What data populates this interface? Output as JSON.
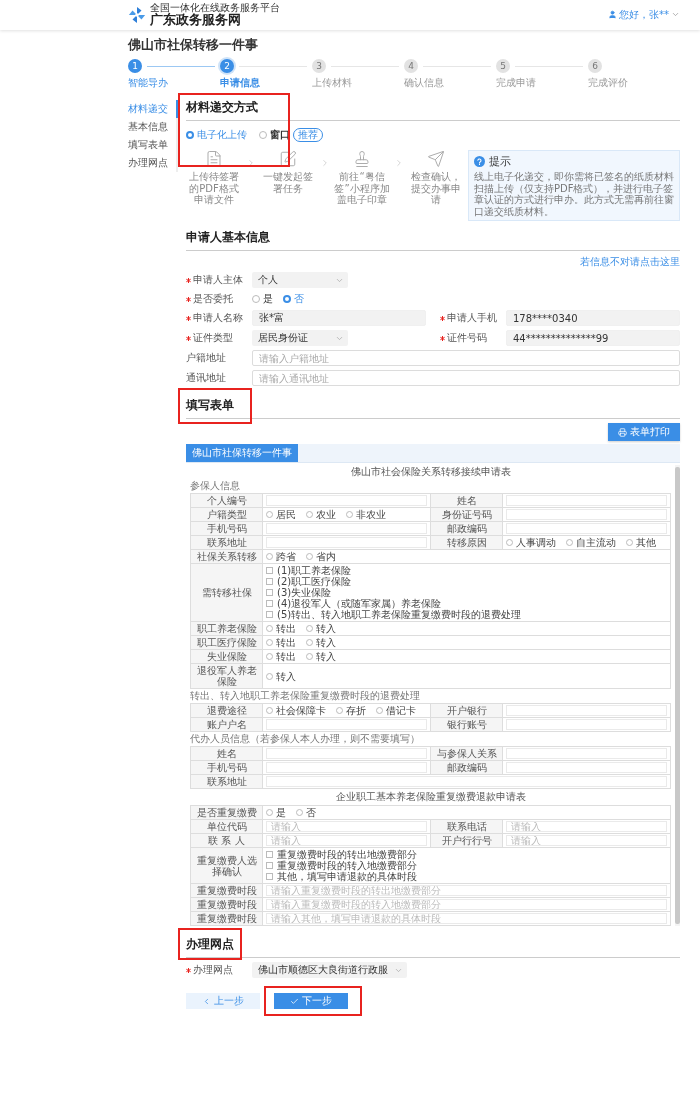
{
  "header": {
    "platform_subtitle": "全国一体化在线政务服务平台",
    "platform_name": "广东政务服务网",
    "user": "您好，张**"
  },
  "page_title": "佛山市社保转移一件事",
  "steps": [
    {
      "number": "1",
      "label": "智能导办",
      "done": true,
      "selected": false
    },
    {
      "number": "2",
      "label": "申请信息",
      "done": false,
      "selected": true
    },
    {
      "number": "3",
      "label": "上传材料",
      "done": false,
      "selected": false
    },
    {
      "number": "4",
      "label": "确认信息",
      "done": false,
      "selected": false
    },
    {
      "number": "5",
      "label": "完成申请",
      "done": false,
      "selected": false
    },
    {
      "number": "6",
      "label": "完成评价",
      "done": false,
      "selected": false
    }
  ],
  "nav": {
    "items": [
      {
        "label": "材料递交",
        "selected": true
      },
      {
        "label": "基本信息",
        "selected": false
      },
      {
        "label": "填写表单",
        "selected": false
      },
      {
        "label": "办理网点",
        "selected": false
      }
    ]
  },
  "materials": {
    "title": "材料递交方式",
    "highlighted": true,
    "options": [
      {
        "label": "电子化上传",
        "selected": true
      },
      {
        "label": "窗口",
        "selected": false,
        "badge": "推荐"
      }
    ],
    "flow": [
      {
        "kind": "pdf",
        "text": "上传待签署的PDF格式申请文件"
      },
      {
        "kind": "edit",
        "text": "一键发起签署任务"
      },
      {
        "kind": "stamp",
        "text": "前往“粤信签”小程序加盖电子印章"
      },
      {
        "kind": "send",
        "text": "检查确认，提交办事申请"
      }
    ],
    "tip": {
      "title": "提示",
      "text": "线上电子化递交，即你需将已签名的纸质材料扫描上传（仅支持PDF格式），并进行电子签章认证的方式进行申办。此方式无需再前往窗口递交纸质材料。"
    }
  },
  "applicant": {
    "title": "申请人基本信息",
    "link": "若信息不对请点击这里",
    "rows": [
      [
        {
          "kind": "select",
          "label": "申请人主体",
          "required": true,
          "value": "个人"
        }
      ],
      [
        {
          "kind": "radio",
          "label": "是否委托",
          "required": true,
          "options": [
            {
              "label": "是",
              "selected": false
            },
            {
              "label": "否",
              "selected": true
            }
          ]
        }
      ],
      [
        {
          "kind": "input",
          "label": "申请人名称",
          "required": true,
          "value": "张*富",
          "readonly": true
        },
        {
          "kind": "input",
          "label": "申请人手机",
          "required": true,
          "value": "178****0340",
          "readonly": true
        }
      ],
      [
        {
          "kind": "select",
          "label": "证件类型",
          "required": true,
          "value": "居民身份证"
        },
        {
          "kind": "input",
          "label": "证件号码",
          "required": true,
          "value": "44**************99",
          "readonly": true
        }
      ],
      [
        {
          "kind": "input",
          "label": "户籍地址",
          "required": false,
          "placeholder": "请输入户籍地址",
          "readonly": false
        }
      ],
      [
        {
          "kind": "input",
          "label": "通讯地址",
          "required": false,
          "placeholder": "请输入通讯地址",
          "readonly": false
        }
      ]
    ]
  },
  "form_section": {
    "title": "填写表单",
    "highlighted": true,
    "print_button": "表单打印",
    "tabs": [
      {
        "label": "佛山市社保转移一件事",
        "selected": true
      }
    ],
    "document": {
      "blocks": [
        {
          "kind": "title",
          "text": "佛山市社会保险关系转移接续申请表"
        },
        {
          "kind": "subheading",
          "text": "参保人信息"
        },
        {
          "kind": "table",
          "rows": [
            {
              "cells": [
                {
                  "kind": "label",
                  "text": "个人编号"
                },
                {
                  "kind": "input"
                },
                {
                  "kind": "label",
                  "text": "姓名"
                },
                {
                  "kind": "input"
                }
              ]
            },
            {
              "cells": [
                {
                  "kind": "label",
                  "text": "户籍类型"
                },
                {
                  "kind": "radios",
                  "options": [
                    {
                      "label": "居民",
                      "selected": false
                    },
                    {
                      "label": "农业",
                      "selected": false
                    },
                    {
                      "label": "非农业",
                      "selected": false
                    }
                  ]
                },
                {
                  "kind": "label",
                  "text": "身份证号码"
                },
                {
                  "kind": "input"
                }
              ]
            },
            {
              "cells": [
                {
                  "kind": "label",
                  "text": "手机号码"
                },
                {
                  "kind": "input"
                },
                {
                  "kind": "label",
                  "text": "邮政编码"
                },
                {
                  "kind": "input"
                }
              ]
            },
            {
              "cells": [
                {
                  "kind": "label",
                  "text": "联系地址"
                },
                {
                  "kind": "input"
                },
                {
                  "kind": "label",
                  "text": "转移原因"
                },
                {
                  "kind": "radios",
                  "options": [
                    {
                      "label": "人事调动",
                      "selected": false
                    },
                    {
                      "label": "自主流动",
                      "selected": false
                    },
                    {
                      "label": "其他",
                      "selected": false
                    }
                  ]
                }
              ]
            },
            {
              "cells": [
                {
                  "kind": "label",
                  "text": "社保关系转移"
                },
                {
                  "kind": "radios",
                  "options": [
                    {
                      "label": "跨省",
                      "selected": false
                    },
                    {
                      "label": "省内",
                      "selected": false
                    }
                  ]
                }
              ]
            },
            {
              "cells": [
                {
                  "kind": "label",
                  "text": "需转移社保"
                },
                {
                  "kind": "checks",
                  "options": [
                    {
                      "label": "(1)职工养老保险",
                      "checked": false
                    },
                    {
                      "label": "(2)职工医疗保险",
                      "checked": false
                    },
                    {
                      "label": "(3)失业保险",
                      "checked": false
                    },
                    {
                      "label": "(4)退役军人（或随军家属）养老保险",
                      "checked": false
                    },
                    {
                      "label": "(5)转出、转入地职工养老保险重复缴费时段的退费处理",
                      "checked": false
                    }
                  ]
                }
              ]
            },
            {
              "cells": [
                {
                  "kind": "label",
                  "text": "职工养老保险"
                },
                {
                  "kind": "radios",
                  "options": [
                    {
                      "label": "转出",
                      "selected": false
                    },
                    {
                      "label": "转入",
                      "selected": false
                    }
                  ]
                }
              ]
            },
            {
              "cells": [
                {
                  "kind": "label",
                  "text": "职工医疗保险"
                },
                {
                  "kind": "radios",
                  "options": [
                    {
                      "label": "转出",
                      "selected": false
                    },
                    {
                      "label": "转入",
                      "selected": false
                    }
                  ]
                }
              ]
            },
            {
              "cells": [
                {
                  "kind": "label",
                  "text": "失业保险"
                },
                {
                  "kind": "radios",
                  "options": [
                    {
                      "label": "转出",
                      "selected": false
                    },
                    {
                      "label": "转入",
                      "selected": false
                    }
                  ]
                }
              ]
            },
            {
              "cells": [
                {
                  "kind": "label",
                  "text": "退役军人养老保险"
                },
                {
                  "kind": "radios",
                  "options": [
                    {
                      "label": "转入",
                      "selected": false
                    }
                  ]
                }
              ]
            }
          ]
        },
        {
          "kind": "subheading",
          "text": "转出、转入地职工养老保险重复缴费时段的退费处理"
        },
        {
          "kind": "table",
          "rows": [
            {
              "cells": [
                {
                  "kind": "label",
                  "text": "退费途径"
                },
                {
                  "kind": "radios",
                  "options": [
                    {
                      "label": "社会保障卡",
                      "selected": false
                    },
                    {
                      "label": "存折",
                      "selected": false
                    },
                    {
                      "label": "借记卡",
                      "selected": false
                    }
                  ]
                },
                {
                  "kind": "label",
                  "text": "开户银行"
                },
                {
                  "kind": "input"
                }
              ]
            },
            {
              "cells": [
                {
                  "kind": "label",
                  "text": "账户户名"
                },
                {
                  "kind": "input"
                },
                {
                  "kind": "label",
                  "text": "银行账号"
                },
                {
                  "kind": "input"
                }
              ]
            }
          ]
        },
        {
          "kind": "subheading",
          "text": "代办人员信息（若参保人本人办理，则不需要填写）"
        },
        {
          "kind": "table",
          "rows": [
            {
              "cells": [
                {
                  "kind": "label",
                  "text": "姓名"
                },
                {
                  "kind": "input"
                },
                {
                  "kind": "label",
                  "text": "与参保人关系"
                },
                {
                  "kind": "input"
                }
              ]
            },
            {
              "cells": [
                {
                  "kind": "label",
                  "text": "手机号码"
                },
                {
                  "kind": "input"
                },
                {
                  "kind": "label",
                  "text": "邮政编码"
                },
                {
                  "kind": "input"
                }
              ]
            },
            {
              "cells": [
                {
                  "kind": "label",
                  "text": "联系地址"
                },
                {
                  "kind": "input"
                }
              ]
            }
          ]
        },
        {
          "kind": "title",
          "text": "企业职工基本养老保险重复缴费退款申请表"
        },
        {
          "kind": "table",
          "rows": [
            {
              "cells": [
                {
                  "kind": "label",
                  "text": "是否重复缴费"
                },
                {
                  "kind": "radios",
                  "options": [
                    {
                      "label": "是",
                      "selected": false
                    },
                    {
                      "label": "否",
                      "selected": false
                    }
                  ]
                }
              ]
            },
            {
              "cells": [
                {
                  "kind": "label",
                  "text": "单位代码"
                },
                {
                  "kind": "input",
                  "placeholder": "请输入"
                },
                {
                  "kind": "label",
                  "text": "联系电话"
                },
                {
                  "kind": "input",
                  "placeholder": "请输入"
                }
              ]
            },
            {
              "cells": [
                {
                  "kind": "label",
                  "text": "联 系 人"
                },
                {
                  "kind": "input",
                  "placeholder": "请输入"
                },
                {
                  "kind": "label",
                  "text": "开户行行号"
                },
                {
                  "kind": "input",
                  "placeholder": "请输入"
                }
              ]
            },
            {
              "cells": [
                {
                  "kind": "label",
                  "text": "重复缴费人选择确认"
                },
                {
                  "kind": "checks",
                  "options": [
                    {
                      "label": "重复缴费时段的转出地缴费部分",
                      "checked": false
                    },
                    {
                      "label": "重复缴费时段的转入地缴费部分",
                      "checked": false
                    },
                    {
                      "label": "其他，填写申请退款的具体时段",
                      "checked": false
                    }
                  ]
                }
              ]
            },
            {
              "cells": [
                {
                  "kind": "label",
                  "text": "重复缴费时段"
                },
                {
                  "kind": "input",
                  "placeholder": "请输入重复缴费时段的转出地缴费部分"
                }
              ]
            },
            {
              "cells": [
                {
                  "kind": "label",
                  "text": "重复缴费时段"
                },
                {
                  "kind": "input",
                  "placeholder": "请输入重复缴费时段的转入地缴费部分"
                }
              ]
            },
            {
              "cells": [
                {
                  "kind": "label",
                  "text": "重复缴费时段"
                },
                {
                  "kind": "input",
                  "placeholder": "请输入其他，填写申请退款的具体时段"
                }
              ]
            }
          ]
        }
      ]
    }
  },
  "network": {
    "title": "办理网点",
    "highlighted": true,
    "field": {
      "label": "办理网点",
      "required": true,
      "value": "佛山市顺德区大良街道行政服"
    }
  },
  "buttons": [
    {
      "label": "上一步",
      "kind": "secondary",
      "highlighted": false
    },
    {
      "label": "下一步",
      "kind": "primary",
      "highlighted": true
    }
  ]
}
